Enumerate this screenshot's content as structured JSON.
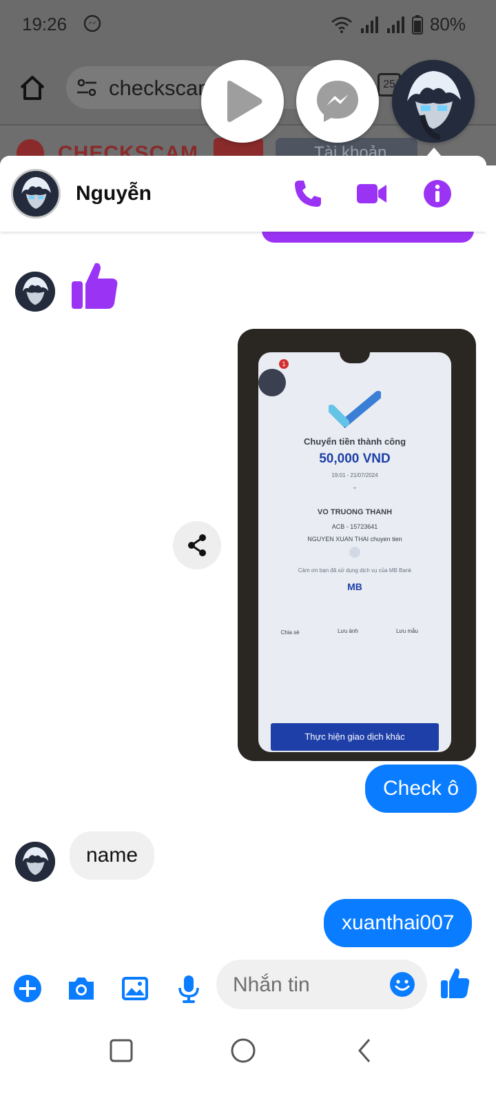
{
  "status_bar": {
    "time": "19:26",
    "battery": "80%"
  },
  "browser": {
    "url": "checkscam",
    "tab_count": "25",
    "site_name": "CHECKSCAM",
    "search_placeholder": "Tài khoản"
  },
  "chat": {
    "contact_name": "Nguyễn",
    "accent_color": "#9b33f5",
    "outgoing_color": "#0a7cff"
  },
  "messages": {
    "outgoing_check": "Check ô",
    "incoming_name": "name",
    "outgoing_username": "xuanthai007"
  },
  "receipt_image": {
    "title": "Chuyển tiền thành công",
    "amount": "50,000 VND",
    "datetime": "19:01 - 21/07/2024",
    "recipient": "VO TRUONG THANH",
    "bank": "ACB - 15723641",
    "memo": "NGUYEN XUAN THAI chuyen tien",
    "thanks": "Cảm ơn bạn đã sử dụng dịch vụ của MB Bank",
    "brand": "MB",
    "actions": [
      "Chia sẻ",
      "Lưu ảnh",
      "Lưu mẫu"
    ],
    "button": "Thực hiện giao dịch khác",
    "badge": "1"
  },
  "composer": {
    "placeholder": "Nhắn tin"
  }
}
